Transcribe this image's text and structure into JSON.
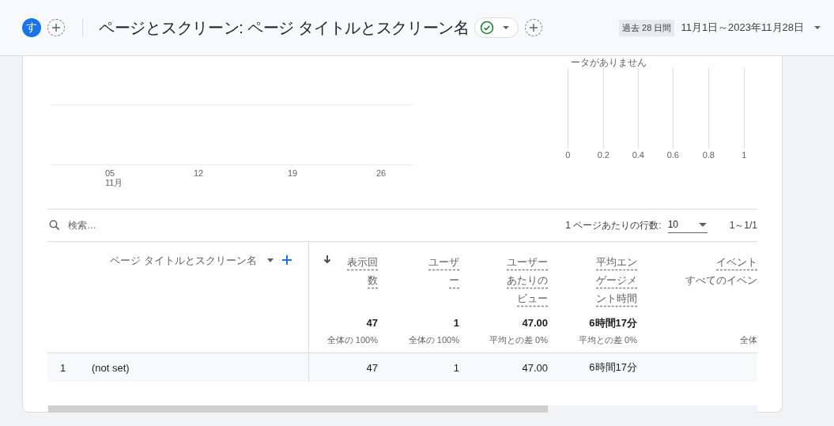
{
  "header": {
    "avatar": "す",
    "title": "ページとスクリーン: ページ タイトルとスクリーン名",
    "date_chip": "過去 28 日間",
    "date_range": "11月1日～2023年11月28日"
  },
  "line_chart": {
    "x_labels": [
      {
        "day": "05",
        "month": "11月"
      },
      {
        "day": "12"
      },
      {
        "day": "19"
      },
      {
        "day": "26"
      }
    ]
  },
  "bar_chart": {
    "message": "ータがありません",
    "x_labels": [
      "0",
      "0.2",
      "0.4",
      "0.6",
      "0.8",
      "1"
    ]
  },
  "table": {
    "search": {
      "placeholder": "検索…"
    },
    "rows_per_page_label": "1 ページあたりの行数:",
    "rows_per_page": "10",
    "pagination": "1～1/1",
    "dimension_label": "ページ タイトルとスクリーン名",
    "columns": [
      {
        "label": "表示回数",
        "sorted": true,
        "total": "47",
        "total_note": "全体の 100%"
      },
      {
        "label": "ユーザー",
        "sorted": false,
        "total": "1",
        "total_note": "全体の 100%"
      },
      {
        "label": "ユーザーあたりのビュー",
        "sorted": false,
        "total": "47.00",
        "total_note": "平均との差 0%"
      },
      {
        "label": "平均エンゲージメント時間",
        "sorted": false,
        "total": "6時間17分",
        "total_note": "平均との差 0%"
      },
      {
        "label": "イベント",
        "sublabel": "すべてのイベン",
        "sorted": false,
        "total_note": "全体"
      }
    ],
    "rows": [
      {
        "index": "1",
        "name": "(not set)",
        "values": [
          "47",
          "1",
          "47.00",
          "6時間17分"
        ]
      }
    ]
  }
}
